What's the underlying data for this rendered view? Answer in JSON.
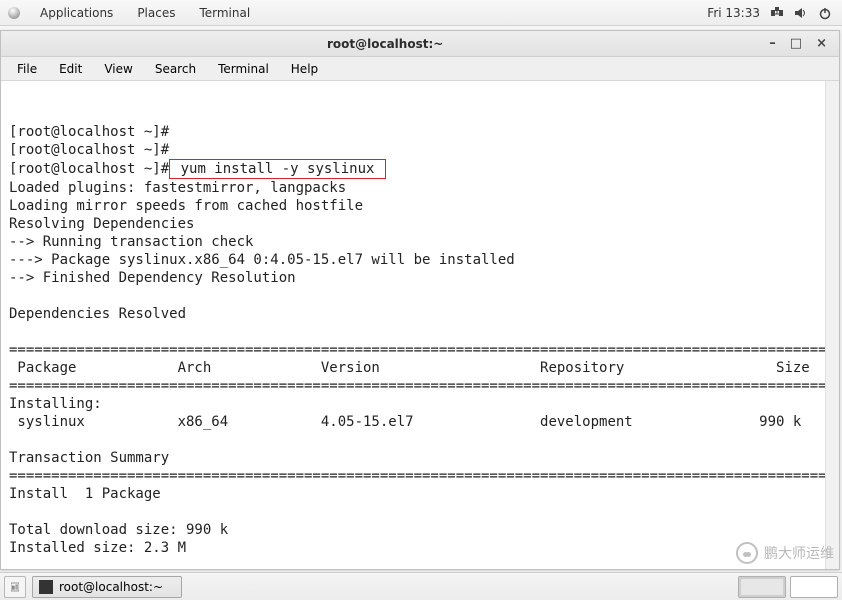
{
  "top_panel": {
    "applications": "Applications",
    "places": "Places",
    "active_app": "Terminal",
    "clock": "Fri 13:33"
  },
  "window": {
    "title": "root@localhost:~",
    "menus": {
      "file": "File",
      "edit": "Edit",
      "view": "View",
      "search": "Search",
      "terminal": "Terminal",
      "help": "Help"
    }
  },
  "terminal": {
    "blank": "",
    "prompt1": "[root@localhost ~]#",
    "prompt2": "[root@localhost ~]#",
    "prompt3_prefix": "[root@localhost ~]#",
    "command": " yum install -y syslinux ",
    "line_plugins": "Loaded plugins: fastestmirror, langpacks",
    "line_mirror": "Loading mirror speeds from cached hostfile",
    "line_resolving": "Resolving Dependencies",
    "line_check": "--> Running transaction check",
    "line_pkg": "---> Package syslinux.x86_64 0:4.05-15.el7 will be installed",
    "line_finished": "--> Finished Dependency Resolution",
    "line_depres": "Dependencies Resolved",
    "sep1": "================================================================================================================",
    "header": " Package            Arch             Version                   Repository                  Size",
    "sep2": "================================================================================================================",
    "group_installing": "Installing:",
    "pkg_row": " syslinux           x86_64           4.05-15.el7               development               990 k",
    "tx_summary": "Transaction Summary",
    "sep3": "================================================================================================================",
    "install_count": "Install  1 Package",
    "dl_size": "Total download size: 990 k",
    "inst_size": "Installed size: 2.3 M"
  },
  "taskbar": {
    "task_label": "root@localhost:~"
  },
  "watermark": "鹏大师运维"
}
